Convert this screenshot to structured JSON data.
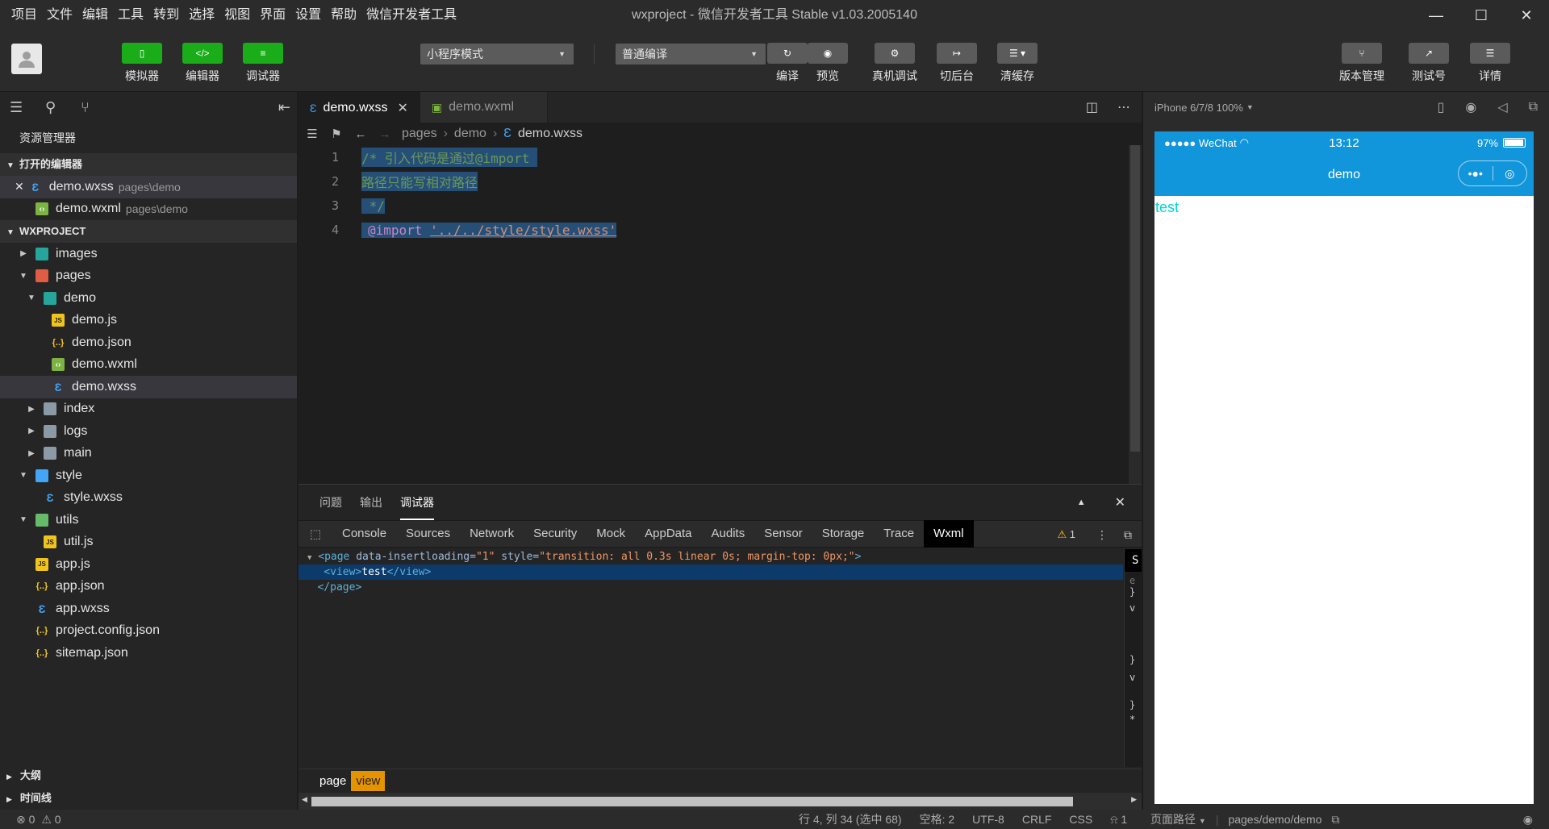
{
  "menubar": {
    "items": [
      "项目",
      "文件",
      "编辑",
      "工具",
      "转到",
      "选择",
      "视图",
      "界面",
      "设置",
      "帮助",
      "微信开发者工具"
    ],
    "window_title": "wxproject - 微信开发者工具 Stable v1.03.2005140"
  },
  "toolbar": {
    "simulator": "模拟器",
    "editor": "编辑器",
    "debugger": "调试器",
    "mode_select": "小程序模式",
    "compile_select": "普通编译",
    "compile": "编译",
    "preview": "预览",
    "remote_debug": "真机调试",
    "background": "切后台",
    "clear_cache": "清缓存",
    "version_mgmt": "版本管理",
    "test_account": "测试号",
    "details": "详情"
  },
  "sidebar": {
    "title": "资源管理器",
    "open_editors_title": "打开的编辑器",
    "open_editors": [
      {
        "name": "demo.wxss",
        "path": "pages\\demo"
      },
      {
        "name": "demo.wxml",
        "path": "pages\\demo"
      }
    ],
    "project_title": "WXPROJECT",
    "tree": [
      {
        "name": "images"
      },
      {
        "name": "pages"
      },
      {
        "name": "demo"
      },
      {
        "name": "demo.js"
      },
      {
        "name": "demo.json"
      },
      {
        "name": "demo.wxml"
      },
      {
        "name": "demo.wxss"
      },
      {
        "name": "index"
      },
      {
        "name": "logs"
      },
      {
        "name": "main"
      },
      {
        "name": "style"
      },
      {
        "name": "style.wxss"
      },
      {
        "name": "utils"
      },
      {
        "name": "util.js"
      },
      {
        "name": "app.js"
      },
      {
        "name": "app.json"
      },
      {
        "name": "app.wxss"
      },
      {
        "name": "project.config.json"
      },
      {
        "name": "sitemap.json"
      }
    ],
    "outline": "大纲",
    "timeline": "时间线"
  },
  "editor": {
    "tabs": [
      {
        "label": "demo.wxss",
        "active": true
      },
      {
        "label": "demo.wxml",
        "active": false
      }
    ],
    "breadcrumb": [
      "pages",
      "demo",
      "demo.wxss"
    ],
    "line_numbers": [
      "1",
      "2",
      "3",
      "4"
    ],
    "lines": [
      "/* 引入代码是通过@import ",
      "路径只能写相对路径",
      " */",
      "@import ",
      "'../../style/style.wxss'"
    ]
  },
  "debug": {
    "tabs": [
      "问题",
      "输出",
      "调试器"
    ],
    "devtools_tabs": [
      "Console",
      "Sources",
      "Network",
      "Security",
      "Mock",
      "AppData",
      "Audits",
      "Sensor",
      "Storage",
      "Trace",
      "Wxml"
    ],
    "warning_count": "1",
    "dom": {
      "page_tag": "page",
      "attr1_name": "data-insertloading",
      "attr1_value": "\"1\"",
      "attr2_name": "style",
      "attr2_value": "\"transition: all 0.3s linear 0s; margin-top: 0px;\"",
      "view_text": "test",
      "close_page": "</page>"
    },
    "styles_pane_letters": [
      "S",
      "e",
      "}",
      "v",
      "}",
      "v",
      "}",
      "*"
    ],
    "crumbs": [
      "page",
      "view"
    ]
  },
  "simulator": {
    "device": "iPhone 6/7/8 100%",
    "carrier": "●●●●● WeChat",
    "time": "13:12",
    "battery": "97%",
    "battery_level": 0.97,
    "nav_title": "demo",
    "page_text": "test"
  },
  "statusbar": {
    "errors": "0",
    "warnings": "0",
    "cursor": "行 4, 列 34 (选中 68)",
    "spaces": "空格: 2",
    "encoding": "UTF-8",
    "eol": "CRLF",
    "lang": "CSS",
    "notifications": "1",
    "page_path_label": "页面路径",
    "page_path": "pages/demo/demo"
  },
  "colors": {
    "accent_green": "#1aad19",
    "nav_blue": "#1296db",
    "selection": "#264f78"
  }
}
